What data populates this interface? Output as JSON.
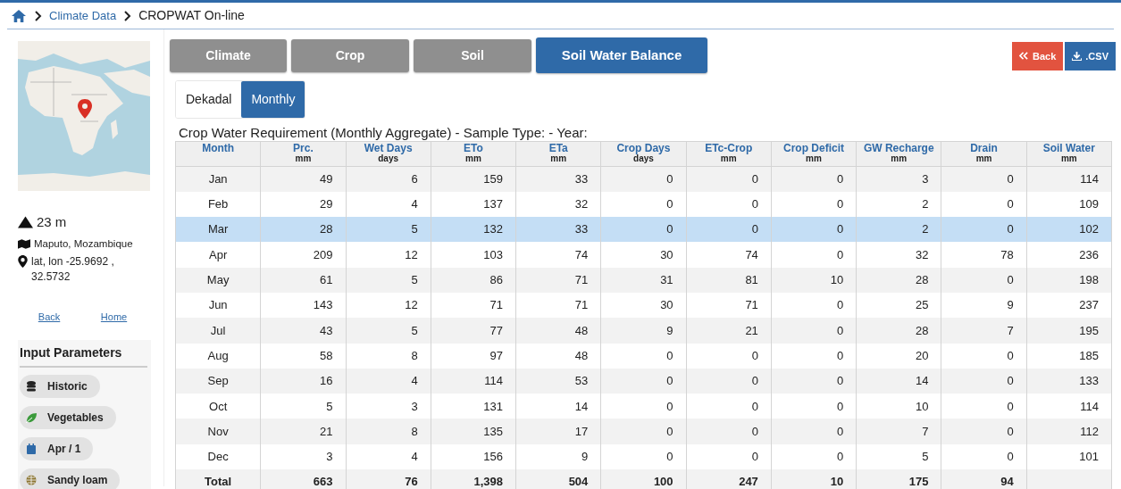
{
  "breadcrumb": [
    {
      "label": "Climate Data",
      "kind": "link"
    },
    {
      "label": "CROPWAT On-line",
      "kind": "current"
    }
  ],
  "sidebar": {
    "elevation": "23 m",
    "location": "Maputo, Mozambique",
    "coordinates": "lat, lon -25.9692 , 32.5732",
    "links": [
      "Back",
      "Home"
    ],
    "input_parameters": {
      "title": "Input Parameters",
      "chips": [
        {
          "kind": "database",
          "label": "Historic"
        },
        {
          "kind": "leaf",
          "label": "Vegetables"
        },
        {
          "kind": "calendar",
          "label": "Apr / 1"
        },
        {
          "kind": "globe",
          "label": "Sandy loam"
        }
      ]
    }
  },
  "tabs": [
    {
      "label": "Climate",
      "selected": false
    },
    {
      "label": "Crop",
      "selected": false
    },
    {
      "label": "Soil",
      "selected": false
    },
    {
      "label": "Soil Water Balance",
      "selected": true
    }
  ],
  "actions": [
    {
      "kind": "back",
      "label": "Back"
    },
    {
      "kind": "download",
      "label": ".CSV"
    }
  ],
  "period_toggle": [
    {
      "label": "Dekadal",
      "selected": false
    },
    {
      "label": "Monthly",
      "selected": true
    }
  ],
  "table": {
    "title": "Crop Water Requirement (Monthly Aggregate) - Sample Type: - Year:",
    "columns": [
      {
        "name": "Month"
      },
      {
        "name": "Prc.",
        "unit": "mm"
      },
      {
        "name": "Wet Days",
        "unit": "days"
      },
      {
        "name": "ETo",
        "unit": "mm"
      },
      {
        "name": "ETa",
        "unit": "mm"
      },
      {
        "name": "Crop Days",
        "unit": "days"
      },
      {
        "name": "ETc-Crop",
        "unit": "mm"
      },
      {
        "name": "Crop Deficit",
        "unit": "mm"
      },
      {
        "name": "GW Recharge",
        "unit": "mm"
      },
      {
        "name": "Drain",
        "unit": "mm"
      },
      {
        "name": "Soil Water",
        "unit": "mm"
      }
    ],
    "rows": [
      {
        "kind": "data",
        "selected": false,
        "cells": [
          "Jan",
          "49",
          "6",
          "159",
          "33",
          "0",
          "0",
          "0",
          "3",
          "0",
          "114"
        ]
      },
      {
        "kind": "data",
        "selected": false,
        "cells": [
          "Feb",
          "29",
          "4",
          "137",
          "32",
          "0",
          "0",
          "0",
          "2",
          "0",
          "109"
        ]
      },
      {
        "kind": "data",
        "selected": true,
        "cells": [
          "Mar",
          "28",
          "5",
          "132",
          "33",
          "0",
          "0",
          "0",
          "2",
          "0",
          "102"
        ]
      },
      {
        "kind": "data",
        "selected": false,
        "cells": [
          "Apr",
          "209",
          "12",
          "103",
          "74",
          "30",
          "74",
          "0",
          "32",
          "78",
          "236"
        ]
      },
      {
        "kind": "data",
        "selected": false,
        "cells": [
          "May",
          "61",
          "5",
          "86",
          "71",
          "31",
          "81",
          "10",
          "28",
          "0",
          "198"
        ]
      },
      {
        "kind": "data",
        "selected": false,
        "cells": [
          "Jun",
          "143",
          "12",
          "71",
          "71",
          "30",
          "71",
          "0",
          "25",
          "9",
          "237"
        ]
      },
      {
        "kind": "data",
        "selected": false,
        "cells": [
          "Jul",
          "43",
          "5",
          "77",
          "48",
          "9",
          "21",
          "0",
          "28",
          "7",
          "195"
        ]
      },
      {
        "kind": "data",
        "selected": false,
        "cells": [
          "Aug",
          "58",
          "8",
          "97",
          "48",
          "0",
          "0",
          "0",
          "20",
          "0",
          "185"
        ]
      },
      {
        "kind": "data",
        "selected": false,
        "cells": [
          "Sep",
          "16",
          "4",
          "114",
          "53",
          "0",
          "0",
          "0",
          "14",
          "0",
          "133"
        ]
      },
      {
        "kind": "data",
        "selected": false,
        "cells": [
          "Oct",
          "5",
          "3",
          "131",
          "14",
          "0",
          "0",
          "0",
          "10",
          "0",
          "114"
        ]
      },
      {
        "kind": "data",
        "selected": false,
        "cells": [
          "Nov",
          "21",
          "8",
          "135",
          "17",
          "0",
          "0",
          "0",
          "7",
          "0",
          "112"
        ]
      },
      {
        "kind": "data",
        "selected": false,
        "cells": [
          "Dec",
          "3",
          "4",
          "156",
          "9",
          "0",
          "0",
          "0",
          "5",
          "0",
          "101"
        ]
      },
      {
        "kind": "total",
        "selected": false,
        "cells": [
          "Total",
          "663",
          "76",
          "1,398",
          "504",
          "100",
          "247",
          "10",
          "175",
          "94",
          ""
        ]
      }
    ]
  }
}
